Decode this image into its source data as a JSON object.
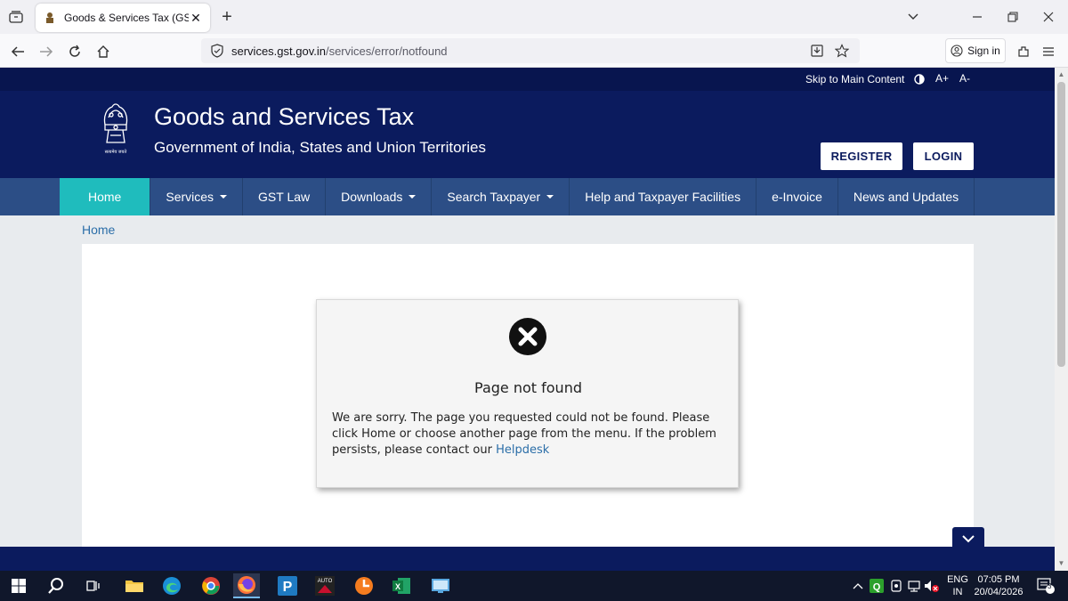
{
  "browser": {
    "tab_title": "Goods & Services Tax (GST) | Not",
    "url_host": "services.gst.gov.in",
    "url_path": "/services/error/notfound",
    "signin_label": "Sign in"
  },
  "utility_bar": {
    "skip_link": "Skip to Main Content",
    "font_increase": "A+",
    "font_decrease": "A-"
  },
  "header": {
    "emblem_caption": "सत्यमेव जयते",
    "title": "Goods and Services Tax",
    "subtitle": "Government of India, States and Union Territories",
    "register_label": "REGISTER",
    "login_label": "LOGIN"
  },
  "nav": {
    "items": [
      {
        "label": "Home"
      },
      {
        "label": "Services"
      },
      {
        "label": "GST Law"
      },
      {
        "label": "Downloads"
      },
      {
        "label": "Search Taxpayer"
      },
      {
        "label": "Help and Taxpayer Facilities"
      },
      {
        "label": "e-Invoice"
      },
      {
        "label": "News and Updates"
      }
    ]
  },
  "breadcrumb": {
    "home": "Home"
  },
  "error": {
    "title": "Page not found",
    "message": "We are sorry. The page you requested could not be found. Please click Home or choose another page from the menu. If the problem persists, please contact our ",
    "link": "Helpdesk"
  },
  "taskbar": {
    "lang": "ENG",
    "region": "IN",
    "time": "07:05 PM",
    "date": "20/04/2026",
    "notification_count": "3",
    "auto_label": "AUTO"
  },
  "colors": {
    "header_bg": "#0b1b5e",
    "nav_bg": "#2c4e86",
    "nav_active": "#1fbcbd",
    "link": "#2b6ea8"
  }
}
